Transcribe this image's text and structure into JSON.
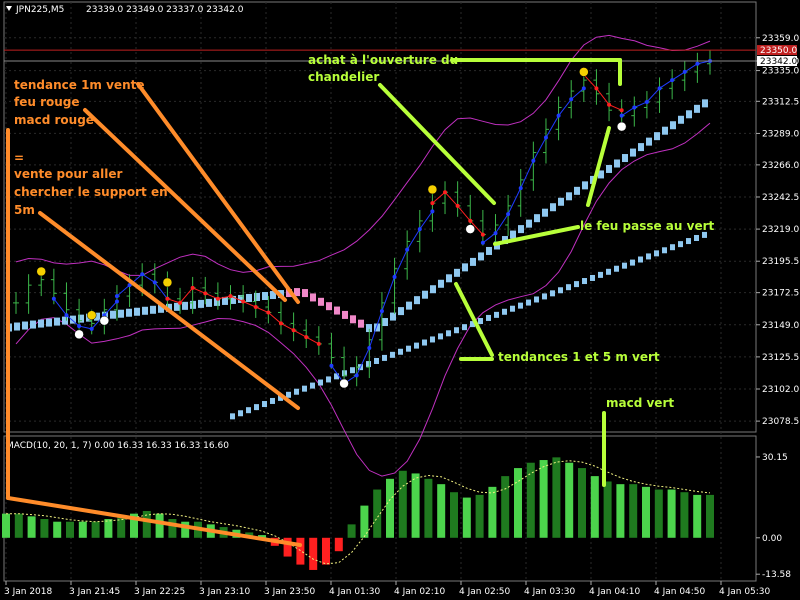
{
  "chart_data": {
    "type": "candlestick",
    "symbol_header": "JPN225,M5",
    "ohlc_header": "23339.0 23349.0 23337.0 23342.0",
    "price_axis": {
      "ticks": [
        23359.0,
        23342.0,
        23335.0,
        23312.5,
        23289.0,
        23266.0,
        23242.5,
        23219.0,
        23195.5,
        23172.5,
        23149.0,
        23125.5,
        23102.0,
        23078.5
      ],
      "range": [
        23072,
        23372
      ]
    },
    "price_tick_labels": [
      "23359.0",
      "23342.0",
      "23335.0",
      "23312.5",
      "23289.0",
      "23266.0",
      "23242.5",
      "23219.0",
      "23195.5",
      "23172.5",
      "23149.0",
      "23125.5",
      "23102.0",
      "23078.5"
    ],
    "current_price_tag": "23350.0",
    "current_price_value": 23350.0,
    "ask_price_tag": "23342.0",
    "ask_price_value": 23342.0,
    "time_axis": [
      "3 Jan 2018",
      "3 Jan 21:45",
      "3 Jan 22:25",
      "3 Jan 23:10",
      "3 Jan 23:50",
      "4 Jan 01:30",
      "4 Jan 02:10",
      "4 Jan 02:50",
      "4 Jan 03:30",
      "4 Jan 04:10",
      "4 Jan 04:50",
      "4 Jan 05:30"
    ],
    "macd_header": "MACD(10, 20, 1, 7) 0.00 16.33 16.33 16.33 16.60",
    "macd_axis": {
      "ticks": [
        30.15,
        0.0,
        -13.58
      ],
      "labels": [
        "30.15",
        "0.00",
        "-13.58"
      ],
      "range": [
        -15,
        32
      ]
    },
    "price_series": [
      23165,
      23178,
      23182,
      23172,
      23160,
      23152,
      23150,
      23160,
      23170,
      23178,
      23186,
      23180,
      23168,
      23165,
      23176,
      23172,
      23168,
      23170,
      23166,
      23162,
      23158,
      23150,
      23145,
      23140,
      23135,
      23125,
      23112,
      23118,
      23138,
      23165,
      23190,
      23210,
      23225,
      23238,
      23246,
      23236,
      23225,
      23215,
      23222,
      23236,
      23255,
      23275,
      23292,
      23308,
      23320,
      23328,
      23318,
      23306,
      23302,
      23308,
      23312,
      23322,
      23328,
      23334,
      23340,
      23342
    ],
    "macd_values": [
      9,
      9,
      8,
      7,
      6,
      6,
      6,
      6,
      7,
      8,
      9,
      10,
      9,
      7,
      6,
      6,
      5,
      4,
      3,
      2,
      1,
      -3,
      -7,
      -10,
      -12,
      -10,
      -5,
      5,
      12,
      18,
      22,
      25,
      24,
      22,
      20,
      17,
      15,
      16,
      19,
      23,
      26,
      28,
      29,
      30,
      28,
      26,
      23,
      21,
      20,
      20,
      19,
      18,
      18,
      17,
      16,
      16
    ],
    "annotations": {
      "sell_trend_line1": "tendance 1m vente",
      "sell_trend_line2": "feu rouge",
      "sell_trend_line3": "macd rouge",
      "equals_sign": "=",
      "sell_support_line1": "vente pour aller",
      "sell_support_line2": "chercher le support en",
      "sell_support_line3": "5m",
      "buy_open_line1": "achat à l'ouverture du",
      "buy_open_line2": "chandelier",
      "light_green": "le feu passe au vert",
      "trends_green": "tendances 1 et 5 m vert",
      "macd_green": "macd vert"
    },
    "colors": {
      "background": "#000000",
      "candle_up": "#3cb84a",
      "grid": "#2a2a2a",
      "bollinger": "#c030c0",
      "trend_1m": "#8fc8f0",
      "trend_5m": "#8fc8f0",
      "trend_1m_sell": "#f088c8",
      "signal_blue": "#1f3cff",
      "signal_red": "#ff2020",
      "macd_bar_green": "#4cd44c",
      "macd_bar_dark": "#1f7a1f",
      "macd_bar_red": "#ff2020",
      "annotation_orange": "#ff8c2a",
      "annotation_green": "#b8ff3a",
      "price_line": "#c02020"
    }
  }
}
